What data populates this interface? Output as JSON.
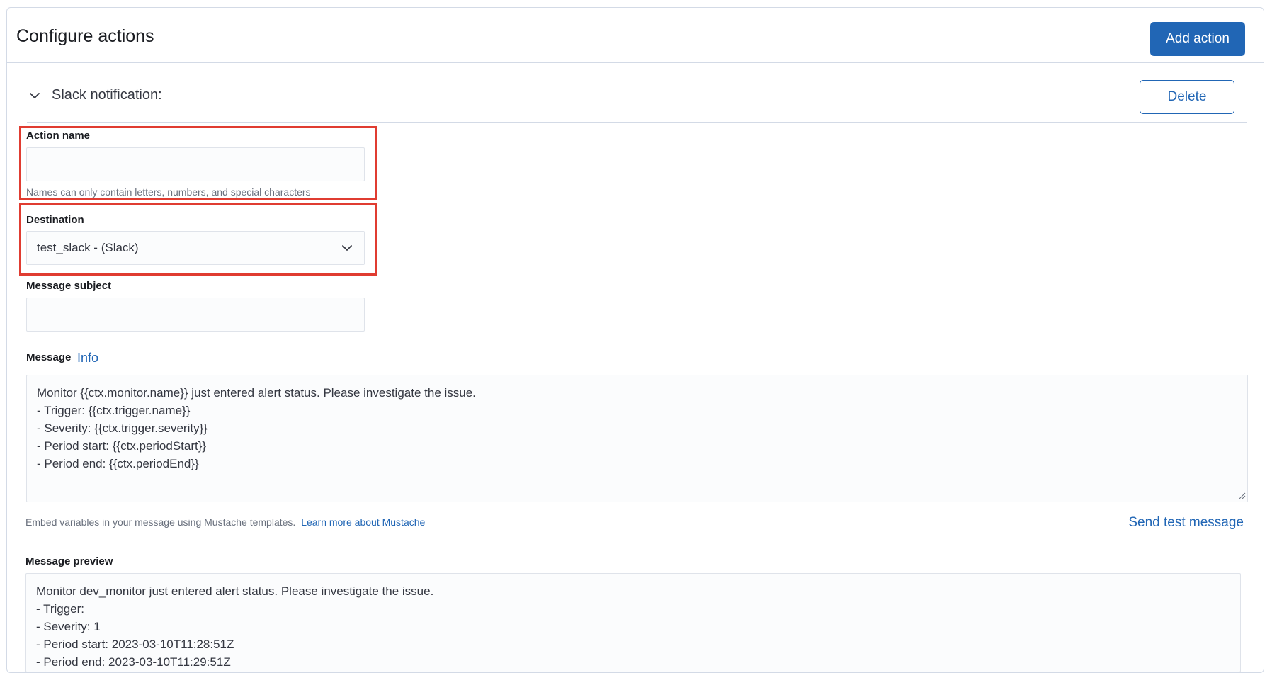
{
  "header": {
    "title": "Configure actions",
    "add_action_label": "Add action"
  },
  "action": {
    "title": "Slack notification:",
    "delete_label": "Delete"
  },
  "fields": {
    "action_name": {
      "label": "Action name",
      "value": "",
      "help": "Names can only contain letters, numbers, and special characters"
    },
    "destination": {
      "label": "Destination",
      "selected": "test_slack - (Slack)"
    },
    "message_subject": {
      "label": "Message subject",
      "value": ""
    },
    "message": {
      "label": "Message",
      "info_label": "Info",
      "lines": [
        "Monitor {{ctx.monitor.name}} just entered alert status. Please investigate the issue.",
        "- Trigger: {{ctx.trigger.name}}",
        "- Severity: {{ctx.trigger.severity}}",
        "- Period start: {{ctx.periodStart}}",
        "- Period end: {{ctx.periodEnd}}"
      ]
    },
    "embed": {
      "text": "Embed variables in your message using Mustache templates.",
      "link_label": "Learn more about Mustache",
      "send_test_label": "Send test message"
    },
    "preview": {
      "label": "Message preview",
      "lines": [
        "Monitor dev_monitor just entered alert status. Please investigate the issue.",
        "- Trigger:",
        "- Severity: 1",
        "- Period start: 2023-03-10T11:28:51Z",
        "- Period end: 2023-03-10T11:29:51Z"
      ]
    }
  },
  "colors": {
    "primary": "#2166b5",
    "highlight": "#e03c31",
    "border": "#d3dae6"
  }
}
